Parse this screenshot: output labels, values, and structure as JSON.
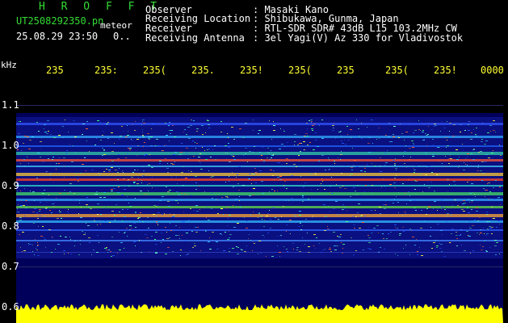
{
  "header": {
    "title": "H R O F F T",
    "filename": "UT2508292350.pn",
    "mode": "meteor",
    "datetime": "25.08.29 23:50",
    "count": "0.."
  },
  "info": {
    "observer_label": "Observer",
    "observer_value": ": Masaki Kano",
    "location_label": "Receiving Location",
    "location_value": ": Shibukawa, Gunma, Japan",
    "receiver_label": "Receiver",
    "receiver_value": ": RTL-SDR SDR# 43dB L15 103.2MHz CW",
    "antenna_label": "Receiving Antenna",
    "antenna_value": ": 3el Yagi(V) Az 330 for Vladivostok"
  },
  "axes": {
    "y_unit": "kHz",
    "x_ticks": [
      "235",
      "235:",
      "235(",
      "235.",
      "235!",
      "235(",
      "235",
      "235(",
      "235!",
      "0000"
    ],
    "y_ticks": [
      "1.1",
      "1.0",
      "0.9",
      "0.8",
      "0.7",
      "0.6"
    ]
  },
  "colors": {
    "title_green": "#33dd33",
    "tick_yellow": "#ffff33",
    "plot_bg": "#00005a",
    "signal_yellow": "#ffff00"
  }
}
